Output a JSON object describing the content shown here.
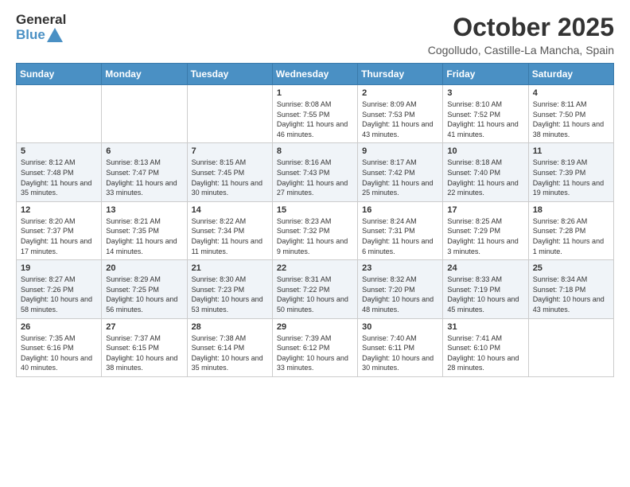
{
  "header": {
    "logo_general": "General",
    "logo_blue": "Blue",
    "month_title": "October 2025",
    "location": "Cogolludo, Castille-La Mancha, Spain"
  },
  "days_of_week": [
    "Sunday",
    "Monday",
    "Tuesday",
    "Wednesday",
    "Thursday",
    "Friday",
    "Saturday"
  ],
  "weeks": [
    [
      {
        "day": "",
        "sunrise": "",
        "sunset": "",
        "daylight": ""
      },
      {
        "day": "",
        "sunrise": "",
        "sunset": "",
        "daylight": ""
      },
      {
        "day": "",
        "sunrise": "",
        "sunset": "",
        "daylight": ""
      },
      {
        "day": "1",
        "sunrise": "Sunrise: 8:08 AM",
        "sunset": "Sunset: 7:55 PM",
        "daylight": "Daylight: 11 hours and 46 minutes."
      },
      {
        "day": "2",
        "sunrise": "Sunrise: 8:09 AM",
        "sunset": "Sunset: 7:53 PM",
        "daylight": "Daylight: 11 hours and 43 minutes."
      },
      {
        "day": "3",
        "sunrise": "Sunrise: 8:10 AM",
        "sunset": "Sunset: 7:52 PM",
        "daylight": "Daylight: 11 hours and 41 minutes."
      },
      {
        "day": "4",
        "sunrise": "Sunrise: 8:11 AM",
        "sunset": "Sunset: 7:50 PM",
        "daylight": "Daylight: 11 hours and 38 minutes."
      }
    ],
    [
      {
        "day": "5",
        "sunrise": "Sunrise: 8:12 AM",
        "sunset": "Sunset: 7:48 PM",
        "daylight": "Daylight: 11 hours and 35 minutes."
      },
      {
        "day": "6",
        "sunrise": "Sunrise: 8:13 AM",
        "sunset": "Sunset: 7:47 PM",
        "daylight": "Daylight: 11 hours and 33 minutes."
      },
      {
        "day": "7",
        "sunrise": "Sunrise: 8:15 AM",
        "sunset": "Sunset: 7:45 PM",
        "daylight": "Daylight: 11 hours and 30 minutes."
      },
      {
        "day": "8",
        "sunrise": "Sunrise: 8:16 AM",
        "sunset": "Sunset: 7:43 PM",
        "daylight": "Daylight: 11 hours and 27 minutes."
      },
      {
        "day": "9",
        "sunrise": "Sunrise: 8:17 AM",
        "sunset": "Sunset: 7:42 PM",
        "daylight": "Daylight: 11 hours and 25 minutes."
      },
      {
        "day": "10",
        "sunrise": "Sunrise: 8:18 AM",
        "sunset": "Sunset: 7:40 PM",
        "daylight": "Daylight: 11 hours and 22 minutes."
      },
      {
        "day": "11",
        "sunrise": "Sunrise: 8:19 AM",
        "sunset": "Sunset: 7:39 PM",
        "daylight": "Daylight: 11 hours and 19 minutes."
      }
    ],
    [
      {
        "day": "12",
        "sunrise": "Sunrise: 8:20 AM",
        "sunset": "Sunset: 7:37 PM",
        "daylight": "Daylight: 11 hours and 17 minutes."
      },
      {
        "day": "13",
        "sunrise": "Sunrise: 8:21 AM",
        "sunset": "Sunset: 7:35 PM",
        "daylight": "Daylight: 11 hours and 14 minutes."
      },
      {
        "day": "14",
        "sunrise": "Sunrise: 8:22 AM",
        "sunset": "Sunset: 7:34 PM",
        "daylight": "Daylight: 11 hours and 11 minutes."
      },
      {
        "day": "15",
        "sunrise": "Sunrise: 8:23 AM",
        "sunset": "Sunset: 7:32 PM",
        "daylight": "Daylight: 11 hours and 9 minutes."
      },
      {
        "day": "16",
        "sunrise": "Sunrise: 8:24 AM",
        "sunset": "Sunset: 7:31 PM",
        "daylight": "Daylight: 11 hours and 6 minutes."
      },
      {
        "day": "17",
        "sunrise": "Sunrise: 8:25 AM",
        "sunset": "Sunset: 7:29 PM",
        "daylight": "Daylight: 11 hours and 3 minutes."
      },
      {
        "day": "18",
        "sunrise": "Sunrise: 8:26 AM",
        "sunset": "Sunset: 7:28 PM",
        "daylight": "Daylight: 11 hours and 1 minute."
      }
    ],
    [
      {
        "day": "19",
        "sunrise": "Sunrise: 8:27 AM",
        "sunset": "Sunset: 7:26 PM",
        "daylight": "Daylight: 10 hours and 58 minutes."
      },
      {
        "day": "20",
        "sunrise": "Sunrise: 8:29 AM",
        "sunset": "Sunset: 7:25 PM",
        "daylight": "Daylight: 10 hours and 56 minutes."
      },
      {
        "day": "21",
        "sunrise": "Sunrise: 8:30 AM",
        "sunset": "Sunset: 7:23 PM",
        "daylight": "Daylight: 10 hours and 53 minutes."
      },
      {
        "day": "22",
        "sunrise": "Sunrise: 8:31 AM",
        "sunset": "Sunset: 7:22 PM",
        "daylight": "Daylight: 10 hours and 50 minutes."
      },
      {
        "day": "23",
        "sunrise": "Sunrise: 8:32 AM",
        "sunset": "Sunset: 7:20 PM",
        "daylight": "Daylight: 10 hours and 48 minutes."
      },
      {
        "day": "24",
        "sunrise": "Sunrise: 8:33 AM",
        "sunset": "Sunset: 7:19 PM",
        "daylight": "Daylight: 10 hours and 45 minutes."
      },
      {
        "day": "25",
        "sunrise": "Sunrise: 8:34 AM",
        "sunset": "Sunset: 7:18 PM",
        "daylight": "Daylight: 10 hours and 43 minutes."
      }
    ],
    [
      {
        "day": "26",
        "sunrise": "Sunrise: 7:35 AM",
        "sunset": "Sunset: 6:16 PM",
        "daylight": "Daylight: 10 hours and 40 minutes."
      },
      {
        "day": "27",
        "sunrise": "Sunrise: 7:37 AM",
        "sunset": "Sunset: 6:15 PM",
        "daylight": "Daylight: 10 hours and 38 minutes."
      },
      {
        "day": "28",
        "sunrise": "Sunrise: 7:38 AM",
        "sunset": "Sunset: 6:14 PM",
        "daylight": "Daylight: 10 hours and 35 minutes."
      },
      {
        "day": "29",
        "sunrise": "Sunrise: 7:39 AM",
        "sunset": "Sunset: 6:12 PM",
        "daylight": "Daylight: 10 hours and 33 minutes."
      },
      {
        "day": "30",
        "sunrise": "Sunrise: 7:40 AM",
        "sunset": "Sunset: 6:11 PM",
        "daylight": "Daylight: 10 hours and 30 minutes."
      },
      {
        "day": "31",
        "sunrise": "Sunrise: 7:41 AM",
        "sunset": "Sunset: 6:10 PM",
        "daylight": "Daylight: 10 hours and 28 minutes."
      },
      {
        "day": "",
        "sunrise": "",
        "sunset": "",
        "daylight": ""
      }
    ]
  ]
}
